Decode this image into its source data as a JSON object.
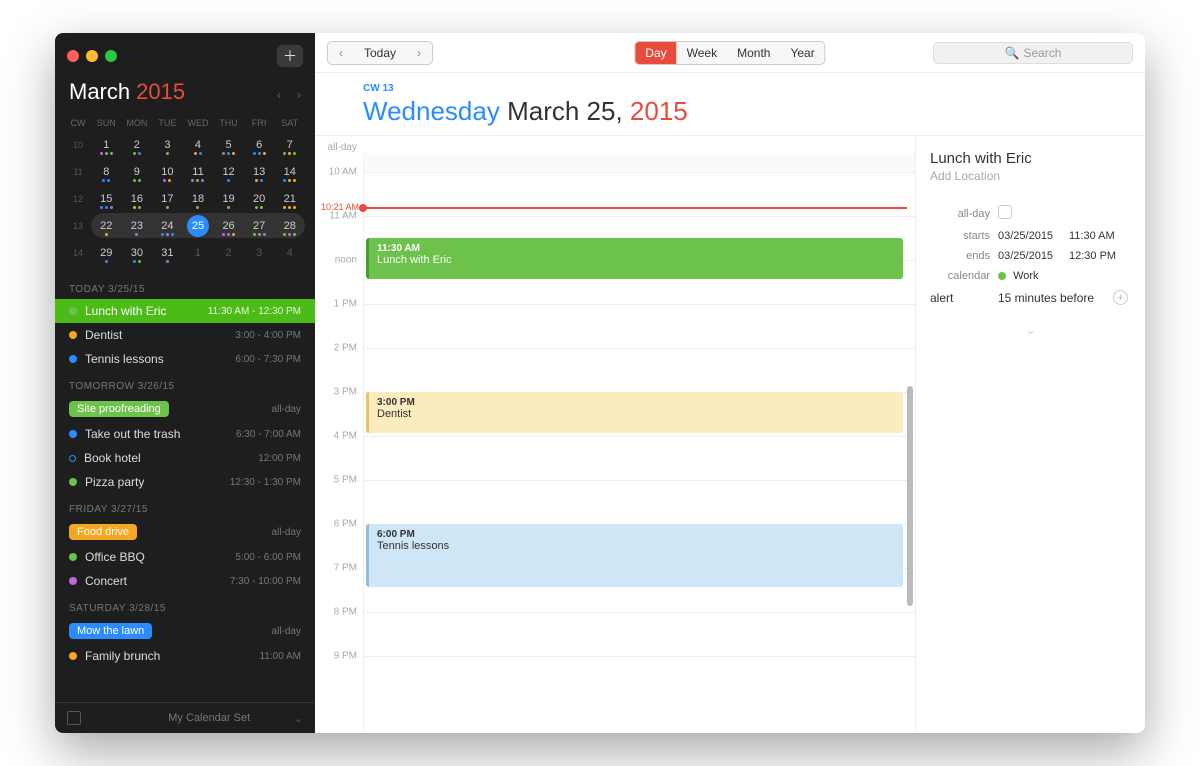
{
  "colors": {
    "green": "#6cc24a",
    "orange": "#f5a623",
    "blue": "#2a8cff",
    "lightBlue": "#8fbde0",
    "purple": "#b86cd9",
    "red": "#e74c3c",
    "yellow": "#f8d568"
  },
  "sidebar": {
    "month": "March",
    "year": "2015",
    "miniCalendar": {
      "dayHeaders": [
        "CW",
        "SUN",
        "MON",
        "TUE",
        "WED",
        "THU",
        "FRI",
        "SAT"
      ],
      "rows": [
        {
          "wk": "10",
          "days": [
            {
              "n": "1",
              "dim": false
            },
            {
              "n": "2"
            },
            {
              "n": "3"
            },
            {
              "n": "4"
            },
            {
              "n": "5"
            },
            {
              "n": "6"
            },
            {
              "n": "7"
            }
          ]
        },
        {
          "wk": "11",
          "days": [
            {
              "n": "8"
            },
            {
              "n": "9"
            },
            {
              "n": "10"
            },
            {
              "n": "11"
            },
            {
              "n": "12"
            },
            {
              "n": "13"
            },
            {
              "n": "14"
            }
          ]
        },
        {
          "wk": "12",
          "days": [
            {
              "n": "15"
            },
            {
              "n": "16"
            },
            {
              "n": "17"
            },
            {
              "n": "18"
            },
            {
              "n": "19"
            },
            {
              "n": "20"
            },
            {
              "n": "21"
            }
          ]
        },
        {
          "wk": "13",
          "selected": true,
          "days": [
            {
              "n": "22"
            },
            {
              "n": "23"
            },
            {
              "n": "24"
            },
            {
              "n": "25",
              "today": true
            },
            {
              "n": "26"
            },
            {
              "n": "27"
            },
            {
              "n": "28"
            }
          ]
        },
        {
          "wk": "14",
          "days": [
            {
              "n": "29"
            },
            {
              "n": "30"
            },
            {
              "n": "31"
            },
            {
              "n": "1",
              "dim": true
            },
            {
              "n": "2",
              "dim": true
            },
            {
              "n": "3",
              "dim": true
            },
            {
              "n": "4",
              "dim": true
            }
          ]
        }
      ]
    },
    "sections": [
      {
        "header": "TODAY 3/25/15",
        "items": [
          {
            "title": "Lunch with Eric",
            "time": "11:30 AM - 12:30 PM",
            "color": "#6cc24a",
            "selected": true
          },
          {
            "title": "Dentist",
            "time": "3:00 - 4:00 PM",
            "color": "#f5a623"
          },
          {
            "title": "Tennis lessons",
            "time": "6:00 - 7:30 PM",
            "color": "#2a8cff"
          }
        ]
      },
      {
        "header": "TOMORROW 3/26/15",
        "items": [
          {
            "tag": "Site proofreading",
            "tagColor": "#6cc24a",
            "time": "all-day"
          },
          {
            "title": "Take out the trash",
            "time": "6:30 - 7:00 AM",
            "color": "#2a8cff"
          },
          {
            "title": "Book hotel",
            "time": "12:00 PM",
            "outline": true
          },
          {
            "title": "Pizza party",
            "time": "12:30 - 1:30 PM",
            "color": "#6cc24a"
          }
        ]
      },
      {
        "header": "FRIDAY 3/27/15",
        "items": [
          {
            "tag": "Food drive",
            "tagColor": "#f5a623",
            "time": "all-day"
          },
          {
            "title": "Office BBQ",
            "time": "5:00 - 6:00 PM",
            "color": "#6cc24a"
          },
          {
            "title": "Concert",
            "time": "7:30 - 10:00 PM",
            "color": "#b86cd9"
          }
        ]
      },
      {
        "header": "SATURDAY 3/28/15",
        "items": [
          {
            "tag": "Mow the lawn",
            "tagColor": "#2a8cff",
            "time": "all-day"
          },
          {
            "title": "Family brunch",
            "time": "11:00 AM",
            "color": "#f5a623"
          }
        ]
      }
    ],
    "footer": "My Calendar Set"
  },
  "toolbar": {
    "today": "Today",
    "views": [
      "Day",
      "Week",
      "Month",
      "Year"
    ],
    "activeView": "Day",
    "searchPlaceholder": "Search"
  },
  "header": {
    "cw": "CW 13",
    "dayOfWeek": "Wednesday",
    "monthDay": "March 25,",
    "year": "2015"
  },
  "timeline": {
    "alldayLabel": "all-day",
    "nowLabel": "10:21 AM",
    "nowOffsetPx": 45,
    "hourPx": 44,
    "startHour": 10,
    "hours": [
      {
        "label": "10 AM",
        "h": 10
      },
      {
        "label": "11 AM",
        "h": 11
      },
      {
        "label": "noon",
        "h": 12
      },
      {
        "label": "1 PM",
        "h": 13
      },
      {
        "label": "2 PM",
        "h": 14
      },
      {
        "label": "3 PM",
        "h": 15
      },
      {
        "label": "4 PM",
        "h": 16
      },
      {
        "label": "5 PM",
        "h": 17
      },
      {
        "label": "6 PM",
        "h": 18
      },
      {
        "label": "7 PM",
        "h": 19
      },
      {
        "label": "8 PM",
        "h": 20
      },
      {
        "label": "9 PM",
        "h": 21
      }
    ],
    "events": [
      {
        "time": "11:30 AM",
        "title": "Lunch with Eric",
        "cls": "green",
        "startH": 11.5,
        "durH": 1.0
      },
      {
        "time": "3:00 PM",
        "title": "Dentist",
        "cls": "yellow",
        "startH": 15.0,
        "durH": 1.0
      },
      {
        "time": "6:00 PM",
        "title": "Tennis lessons",
        "cls": "blue",
        "startH": 18.0,
        "durH": 1.5
      }
    ],
    "scrollThumb": {
      "topPx": 250,
      "heightPx": 220
    }
  },
  "inspector": {
    "title": "Lunch with Eric",
    "locationPlaceholder": "Add Location",
    "rows": {
      "allday": {
        "label": "all-day"
      },
      "starts": {
        "label": "starts",
        "date": "03/25/2015",
        "time": "11:30 AM"
      },
      "ends": {
        "label": "ends",
        "date": "03/25/2015",
        "time": "12:30 PM"
      },
      "calendar": {
        "label": "calendar",
        "name": "Work",
        "color": "#6cc24a"
      },
      "alert": {
        "label": "alert",
        "value": "15 minutes before"
      }
    }
  }
}
